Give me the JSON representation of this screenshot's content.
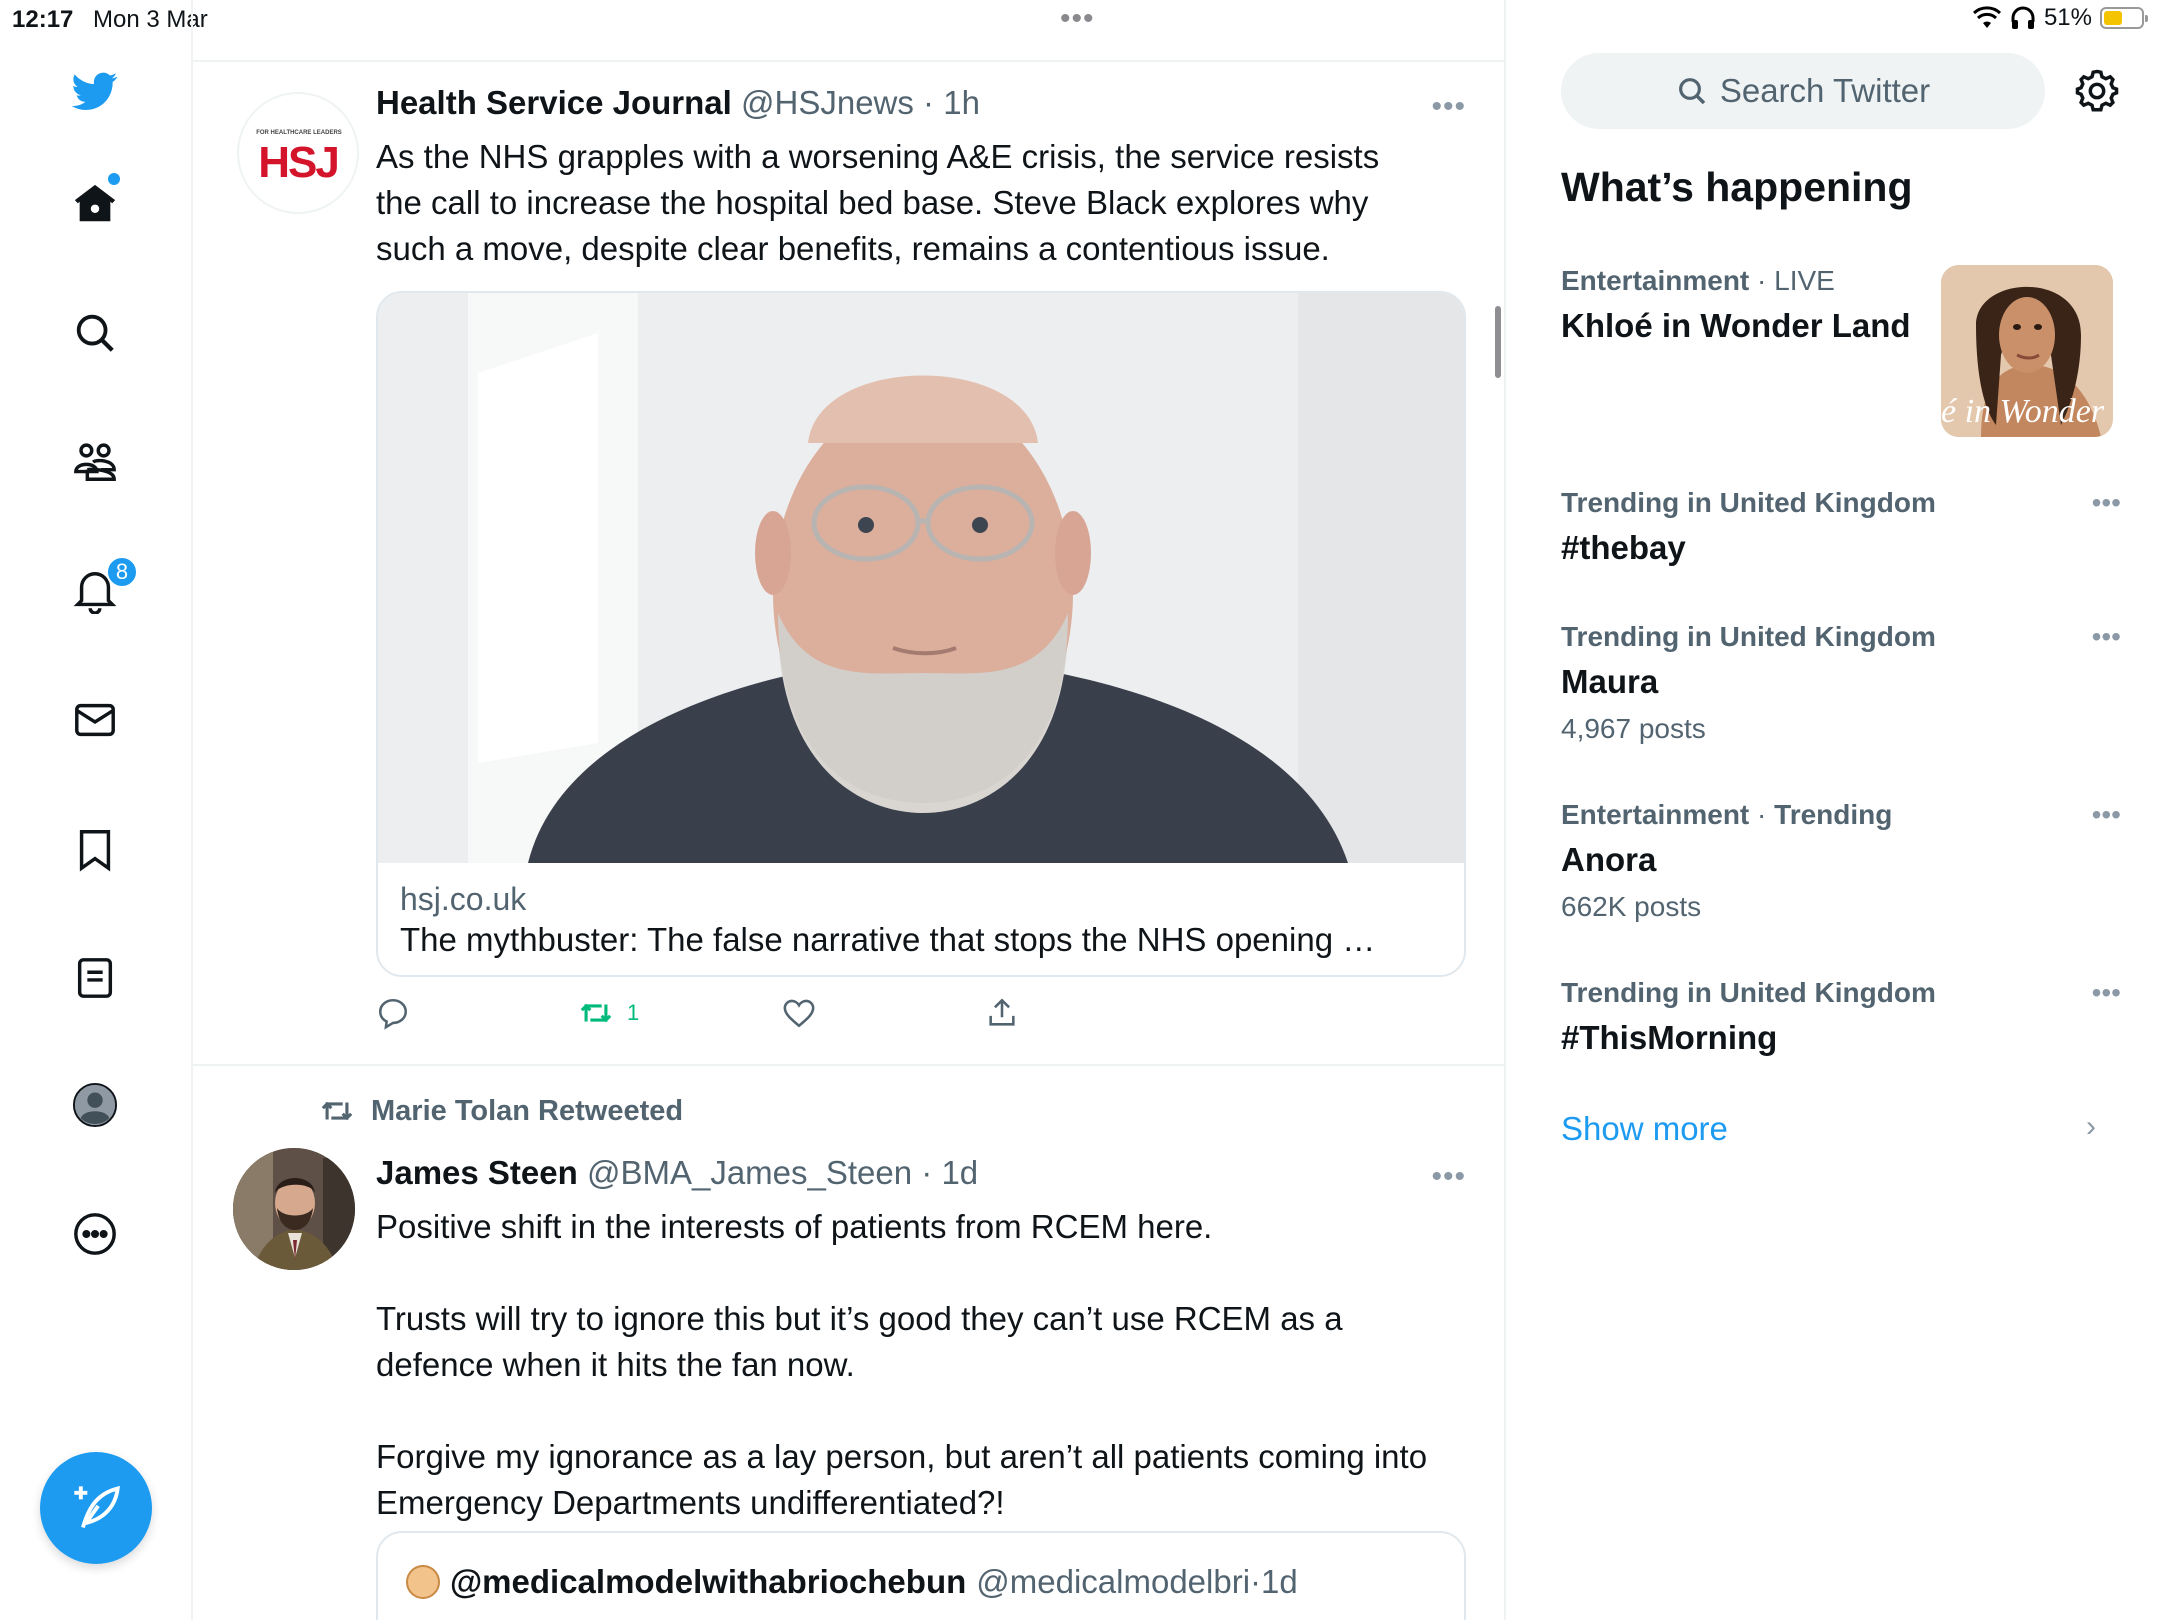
{
  "status_bar": {
    "time": "12:17",
    "date": "Mon 3 Mar",
    "battery_percent": "51%",
    "battery_level": 0.51
  },
  "nav": {
    "notifications_badge": "8",
    "icons": [
      "twitter-logo-icon",
      "home-icon",
      "search-icon",
      "communities-icon",
      "notifications-icon",
      "messages-icon",
      "bookmarks-icon",
      "lists-icon",
      "profile-icon",
      "more-icon",
      "compose-icon"
    ]
  },
  "colors": {
    "accent": "#1d9bf0",
    "retweet_green": "#00ba7c",
    "muted": "#536471"
  },
  "feed": {
    "tweet1": {
      "avatar_logo_small": "FOR HEALTHCARE LEADERS",
      "avatar_logo": "HSJ",
      "name": "Health Service Journal",
      "handle": "@HSJnews",
      "time": "1h",
      "text_lines": [
        "As the NHS grapples with a worsening A&E crisis, the service resists",
        "the call to increase the hospital bed base. Steve Black explores why",
        "such a move, despite clear benefits, remains a contentious issue."
      ],
      "card_domain": "hsj.co.uk",
      "card_title": "The mythbuster: The false narrative that stops the NHS opening …",
      "retweet_count": "1"
    },
    "tweet2": {
      "retweeted_by": "Marie Tolan Retweeted",
      "name": "James Steen",
      "handle": "@BMA_James_Steen",
      "time": "1d",
      "para1": "Positive shift in the interests of patients from RCEM here.",
      "para2_lines": [
        "Trusts will try to ignore this but it’s good they can’t use RCEM as a",
        "defence when it hits the fan now."
      ],
      "para3_lines": [
        "Forgive my ignorance as a lay person, but aren’t all patients coming into",
        "Emergency Departments undifferentiated?!"
      ],
      "quote_name": "@medicalmodelwithabriochebun",
      "quote_handle": "@medicalmodelbri",
      "quote_time": "1d"
    }
  },
  "sidebar": {
    "search_placeholder": "Search Twitter",
    "heading": "What’s happening",
    "trends": [
      {
        "category": "Entertainment",
        "context": "LIVE",
        "title": "Khloé in Wonder Land",
        "thumb_text": "é in Wonder L"
      },
      {
        "category": "Trending in United Kingdom",
        "title": "#thebay"
      },
      {
        "category": "Trending in United Kingdom",
        "title": "Maura",
        "count": "4,967 posts"
      },
      {
        "category": "Entertainment",
        "context": "Trending",
        "title": "Anora",
        "count": "662K posts"
      },
      {
        "category": "Trending in United Kingdom",
        "title": "#ThisMorning"
      }
    ],
    "show_more": "Show more"
  }
}
